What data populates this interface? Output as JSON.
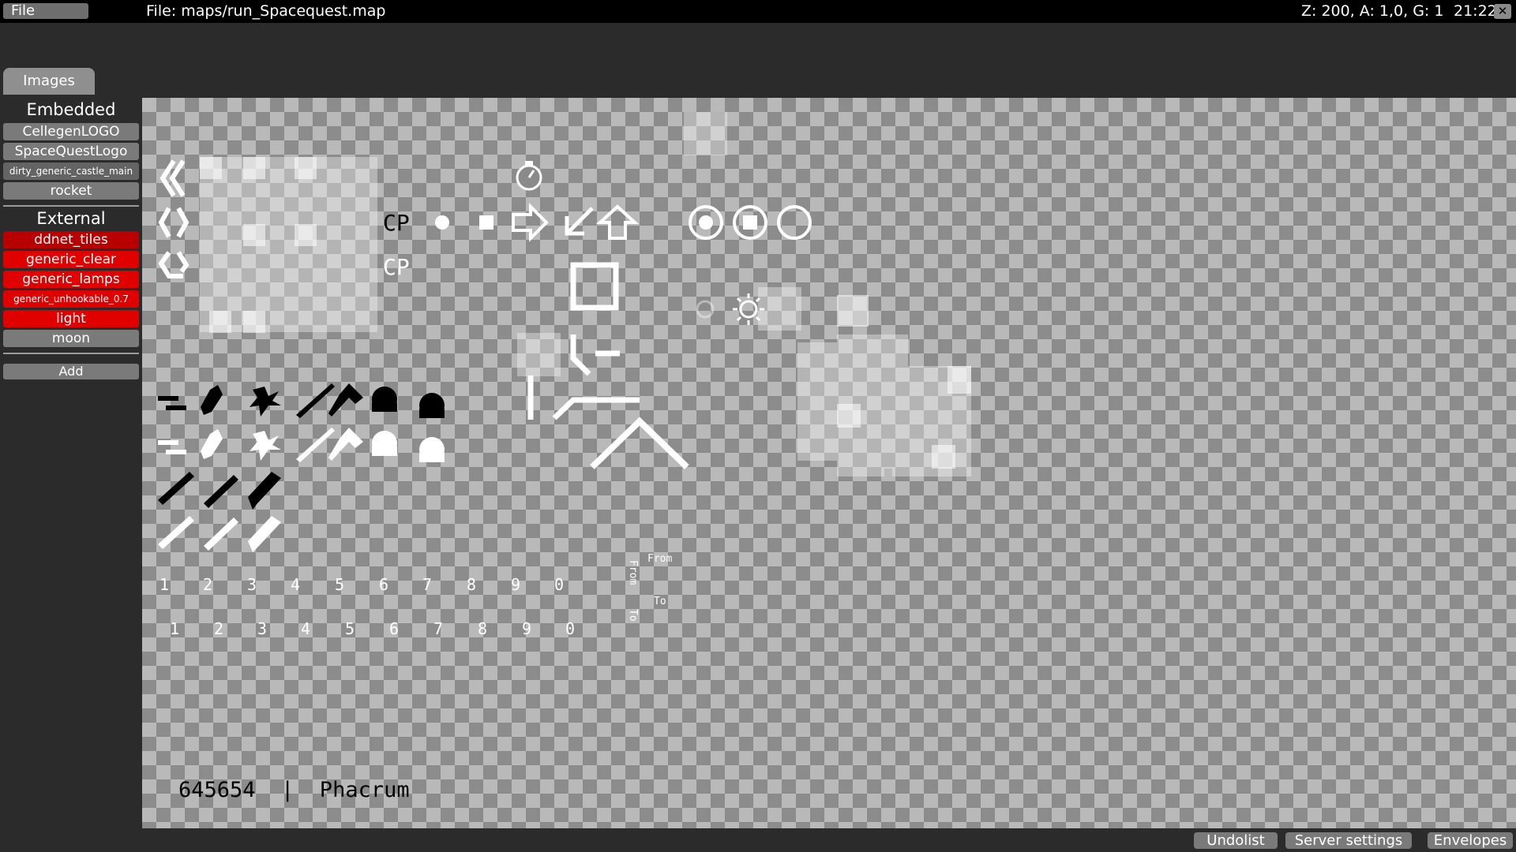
{
  "menu": {
    "file_label": "File"
  },
  "title_bar": {
    "file_title": "File: maps/run_Spacequest.map",
    "status": "Z: 200, A: 1,0, G: 1",
    "clock": "21:22",
    "close_icon": "close-icon"
  },
  "tabs": {
    "images": "Images"
  },
  "sidebar": {
    "embedded_heading": "Embedded",
    "embedded": [
      "CellegenLOGO",
      "SpaceQuestLogo",
      "dirty_generic_castle_main",
      "rocket"
    ],
    "external_heading": "External",
    "external": [
      "ddnet_tiles",
      "generic_clear",
      "generic_lamps",
      "generic_unhookable_0.7",
      "light",
      "moon"
    ],
    "add_label": "Add"
  },
  "tileset": {
    "cp_label": "CP",
    "digits_row1": [
      "1",
      "2",
      "3",
      "4",
      "5",
      "6",
      "7",
      "8",
      "9",
      "0"
    ],
    "digits_row2": [
      "1",
      "2",
      "3",
      "4",
      "5",
      "6",
      "7",
      "8",
      "9",
      "0"
    ],
    "from_label": "From",
    "to_label": "To",
    "caption": "645654  |  Phacrum",
    "icons": [
      "double-chevron-left-icon",
      "angle-brackets-icon",
      "rotate-icon",
      "stopwatch-icon",
      "filled-circle-icon",
      "filled-square-icon",
      "arrow-right-icon",
      "arrow-down-left-icon",
      "arrow-up-icon",
      "radio-dot-icon",
      "radio-square-icon",
      "radio-empty-icon",
      "sun-icon",
      "hammer-icon",
      "shotgun-icon",
      "ninja-star-icon",
      "grenade-icon",
      "laser-icon"
    ]
  },
  "bottom_buttons": {
    "undolist": "Undolist",
    "server_settings": "Server settings",
    "envelopes": "Envelopes"
  }
}
